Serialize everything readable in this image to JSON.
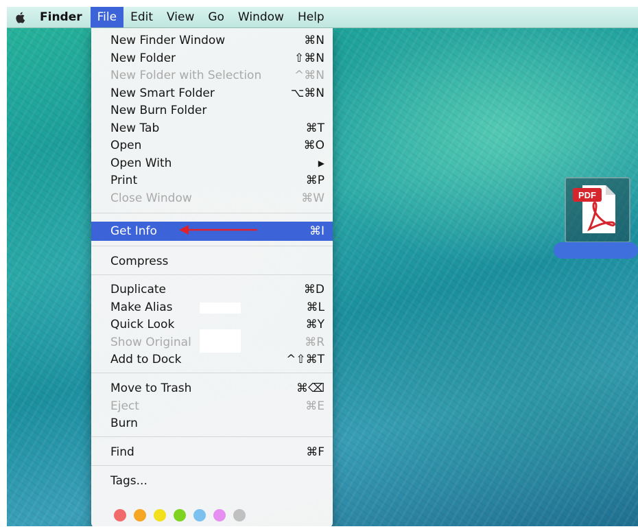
{
  "menubar": {
    "apple_icon": "apple-logo-icon",
    "items": [
      "Finder",
      "File",
      "Edit",
      "View",
      "Go",
      "Window",
      "Help"
    ]
  },
  "menu": {
    "items": [
      {
        "label": "New Finder Window",
        "shortcut": "⌘N"
      },
      {
        "label": "New Folder",
        "shortcut": "⇧⌘N"
      },
      {
        "label": "New Folder with Selection",
        "shortcut": "^⌘N"
      },
      {
        "label": "New Smart Folder",
        "shortcut": "⌥⌘N"
      },
      {
        "label": "New Burn Folder",
        "shortcut": ""
      },
      {
        "label": "New Tab",
        "shortcut": "⌘T"
      },
      {
        "label": "Open",
        "shortcut": "⌘O"
      },
      {
        "label": "Open With",
        "shortcut": "▶"
      },
      {
        "label": "Print",
        "shortcut": "⌘P"
      },
      {
        "label": "Close Window",
        "shortcut": "⌘W"
      },
      {
        "label": "Get Info",
        "shortcut": "⌘I"
      },
      {
        "label": "Compress",
        "shortcut": ""
      },
      {
        "label": "Duplicate",
        "shortcut": "⌘D"
      },
      {
        "label": "Make Alias",
        "shortcut": "⌘L"
      },
      {
        "label": "Quick Look",
        "shortcut": "⌘Y"
      },
      {
        "label": "Show Original",
        "shortcut": "⌘R"
      },
      {
        "label": "Add to Dock",
        "shortcut": "^⇧⌘T"
      },
      {
        "label": "Move to Trash",
        "shortcut": "⌘⌫"
      },
      {
        "label": "Eject",
        "shortcut": "⌘E"
      },
      {
        "label": "Burn",
        "shortcut": ""
      },
      {
        "label": "Find",
        "shortcut": "⌘F"
      },
      {
        "label": "Tags...",
        "shortcut": ""
      }
    ],
    "tag_colors": [
      "#f26b6b",
      "#f5a623",
      "#f2e01d",
      "#7ed321",
      "#7cc0f0",
      "#e58ff0",
      "#c0c0c0"
    ]
  },
  "desktop": {
    "file_badge": "PDF"
  },
  "colors": {
    "highlight": "#3c64d8",
    "annotation_arrow": "#e0202a"
  }
}
